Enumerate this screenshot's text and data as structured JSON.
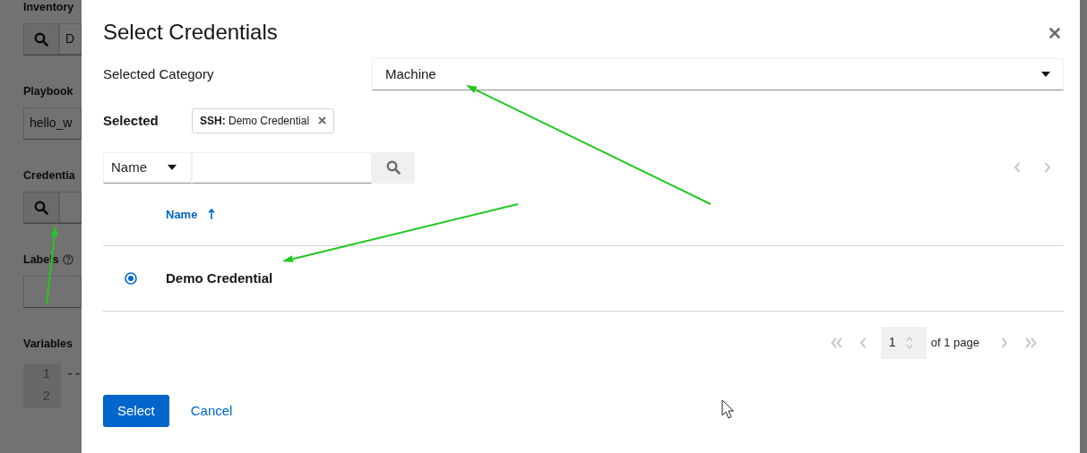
{
  "background_form": {
    "fields": [
      {
        "label": "Inventory",
        "kind": "lookup",
        "value": "D"
      },
      {
        "label": "Playbook",
        "kind": "text",
        "value": "hello_w"
      },
      {
        "label": "Credentia",
        "kind": "lookup"
      },
      {
        "label": "Labels",
        "kind": "text",
        "help": true
      },
      {
        "label": "Variables",
        "kind": "editor",
        "lines": [
          {
            "number": "1",
            "text": "--"
          },
          {
            "number": "2"
          }
        ]
      }
    ]
  },
  "modal": {
    "title": "Select Credentials",
    "category": {
      "label": "Selected Category",
      "value": "Machine"
    },
    "selected": {
      "label": "Selected",
      "chips": [
        "**SSH:** Demo Credential"
      ]
    },
    "search": {
      "filter": "Name"
    },
    "table": {
      "columns": [
        {
          "label": "Name",
          "sorted_ascending": true
        }
      ],
      "rows": [
        {
          "name": "Demo Credential",
          "selected": true
        }
      ]
    },
    "pagination": {
      "page": "1",
      "total": "of 1 page"
    },
    "buttons": [
      {
        "label": "Select",
        "kind": "primary"
      },
      {
        "label": "Cancel",
        "kind": "link"
      }
    ]
  }
}
